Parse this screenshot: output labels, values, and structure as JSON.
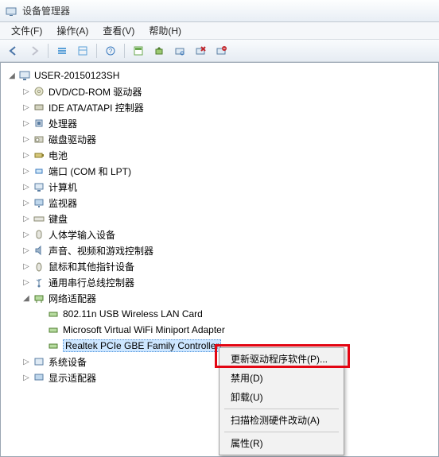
{
  "window": {
    "title": "设备管理器"
  },
  "menu": {
    "file": "文件(F)",
    "action": "操作(A)",
    "view": "查看(V)",
    "help": "帮助(H)"
  },
  "tree": {
    "root": {
      "label": "USER-20150123SH"
    },
    "items": [
      {
        "label": "DVD/CD-ROM 驱动器"
      },
      {
        "label": "IDE ATA/ATAPI 控制器"
      },
      {
        "label": "处理器"
      },
      {
        "label": "磁盘驱动器"
      },
      {
        "label": "电池"
      },
      {
        "label": "端口 (COM 和 LPT)"
      },
      {
        "label": "计算机"
      },
      {
        "label": "监视器"
      },
      {
        "label": "键盘"
      },
      {
        "label": "人体学输入设备"
      },
      {
        "label": "声音、视频和游戏控制器"
      },
      {
        "label": "鼠标和其他指针设备"
      },
      {
        "label": "通用串行总线控制器"
      },
      {
        "label": "网络适配器"
      },
      {
        "label": "系统设备"
      },
      {
        "label": "显示适配器"
      }
    ],
    "network_children": [
      {
        "label": "802.11n USB Wireless LAN Card"
      },
      {
        "label": "Microsoft Virtual WiFi Miniport Adapter"
      },
      {
        "label": "Realtek PCIe GBE Family Controller"
      }
    ]
  },
  "ctx": {
    "update": "更新驱动程序软件(P)...",
    "disable": "禁用(D)",
    "uninstall": "卸载(U)",
    "scan": "扫描检测硬件改动(A)",
    "properties": "属性(R)"
  }
}
